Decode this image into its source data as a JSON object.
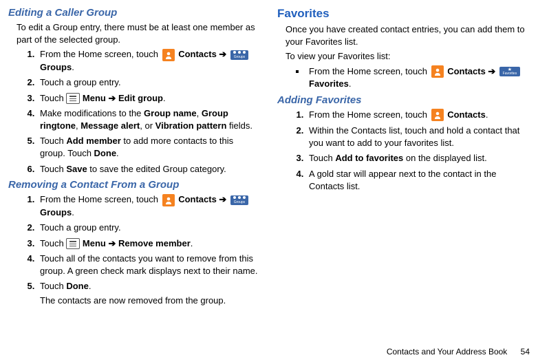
{
  "left": {
    "h_edit": "Editing a Caller Group",
    "edit_intro": "To edit a Group entry, there must be at least one member as part of the selected group.",
    "edit_steps": {
      "s1a": "From the Home screen, touch ",
      "s1b": " Contacts ➔ ",
      "s1c": " Groups",
      "s1d": ".",
      "s2": "Touch a group entry.",
      "s3a": "Touch ",
      "s3b": " Menu ➔ Edit group",
      "s3c": ".",
      "s4a": "Make modifications to the ",
      "s4b": "Group name",
      "s4c": ", ",
      "s4d": "Group ringtone",
      "s4e": ", ",
      "s4f": "Message alert",
      "s4g": ", or ",
      "s4h": "Vibration pattern",
      "s4i": " fields.",
      "s5a": "Touch ",
      "s5b": "Add member",
      "s5c": " to add more contacts to this group. Touch ",
      "s5d": "Done",
      "s5e": ".",
      "s6a": "Touch ",
      "s6b": "Save",
      "s6c": " to save the edited Group category."
    },
    "h_remove": "Removing a Contact From a Group",
    "remove_steps": {
      "s1a": "From the Home screen, touch ",
      "s1b": " Contacts ➔ ",
      "s1c": " Groups",
      "s1d": ".",
      "s2": "Touch a group entry.",
      "s3a": "Touch ",
      "s3b": " Menu ➔ Remove member",
      "s3c": ".",
      "s4": "Touch all of the contacts you want to remove from this group. A green check mark displays next to their name.",
      "s5a": "Touch ",
      "s5b": "Done",
      "s5c": ".",
      "s5note": "The contacts are now removed from the group."
    }
  },
  "right": {
    "h_fav": "Favorites",
    "fav_intro": "Once you have created contact entries, you can add them to your Favorites list.",
    "fav_view": "To view your Favorites list:",
    "fav_bullet": {
      "a": "From the Home screen, touch ",
      "b": " Contacts ➔ ",
      "c": " Favorites",
      "d": "."
    },
    "h_add": "Adding Favorites",
    "add_steps": {
      "s1a": "From the Home screen, touch ",
      "s1b": " Contacts",
      "s1c": ".",
      "s2": "Within the Contacts list, touch and hold a contact that you want to add to your favorites list.",
      "s3a": "Touch ",
      "s3b": "Add to favorites",
      "s3c": " on the displayed list.",
      "s4": "A gold star will appear next to the contact in the Contacts list."
    }
  },
  "icons": {
    "groups_label": "Groups",
    "fav_label": "Favorites"
  },
  "footer": {
    "section": "Contacts and Your Address Book",
    "page": "54"
  }
}
